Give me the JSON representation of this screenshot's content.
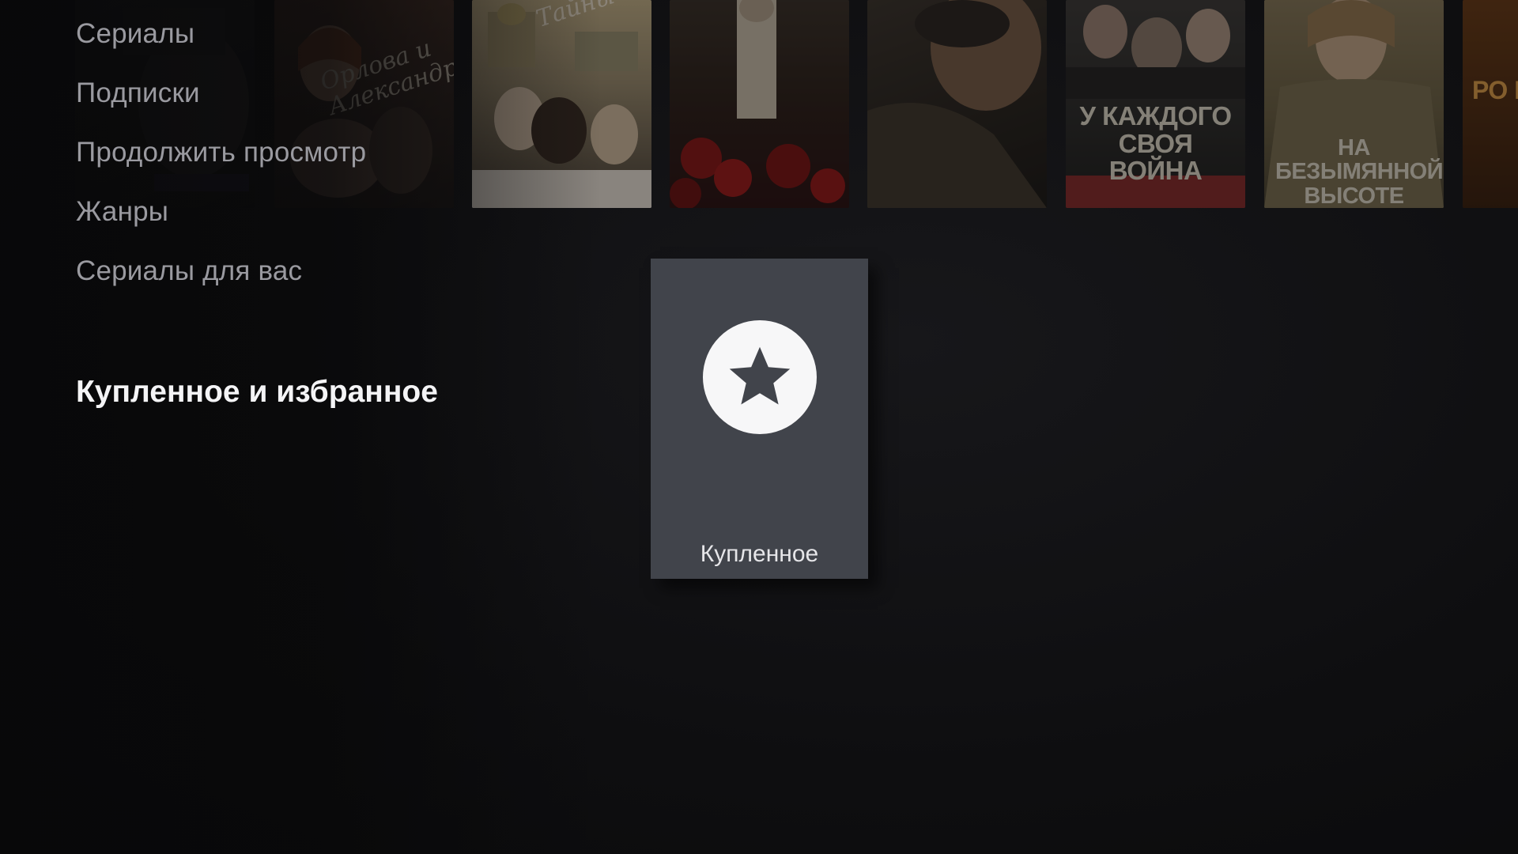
{
  "menu": {
    "items": [
      {
        "label": "Сериалы"
      },
      {
        "label": "Подписки"
      },
      {
        "label": "Продолжить просмотр"
      },
      {
        "label": "Жанры"
      },
      {
        "label": "Сериалы для вас"
      }
    ]
  },
  "section": {
    "title": "Купленное и избранное"
  },
  "card": {
    "label": "Купленное",
    "icon": "star-icon"
  },
  "posters": [
    {
      "title": ""
    },
    {
      "title": "Орлова и Александров"
    },
    {
      "title": "Тайны"
    },
    {
      "title": ""
    },
    {
      "title": ""
    },
    {
      "title": "У каждого своя война"
    },
    {
      "title": "На безымянной высоте"
    },
    {
      "title": "Ро ре"
    }
  ],
  "colors": {
    "background": "#0f0f10",
    "card": "#41444b",
    "menu_text": "#9a9aa0",
    "title_text": "#f4f4f6"
  }
}
